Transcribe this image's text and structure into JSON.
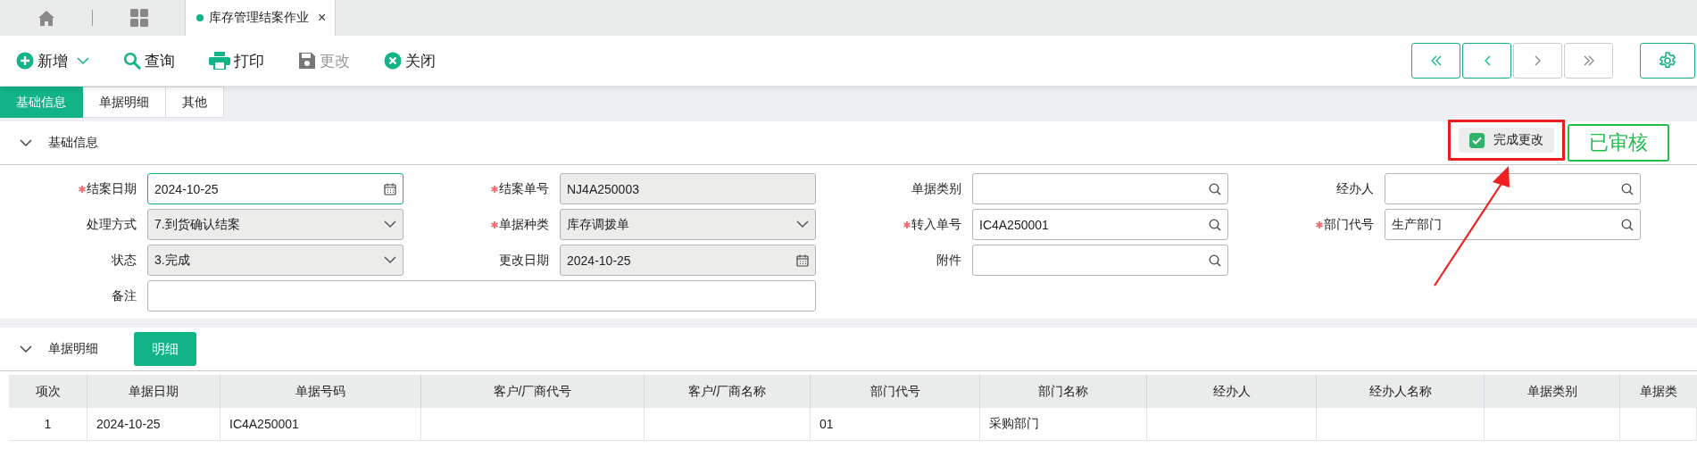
{
  "tab_bar": {
    "tabs": [
      {
        "title": "库存管理结案作业",
        "close": "×",
        "selected": true
      }
    ]
  },
  "toolbar": {
    "buttons": [
      {
        "label": "新增",
        "kind": "add",
        "disabled": false,
        "dropdown": true
      },
      {
        "label": "查询",
        "kind": "search",
        "disabled": false,
        "dropdown": false
      },
      {
        "label": "打印",
        "kind": "print",
        "disabled": false,
        "dropdown": false
      },
      {
        "label": "更改",
        "kind": "save",
        "disabled": true,
        "dropdown": false
      },
      {
        "label": "关闭",
        "kind": "close",
        "disabled": false,
        "dropdown": false
      }
    ],
    "nav_buttons": [
      {
        "kind": "first",
        "disabled": false
      },
      {
        "kind": "prev",
        "disabled": false
      },
      {
        "kind": "next",
        "disabled": true
      },
      {
        "kind": "last",
        "disabled": true
      }
    ]
  },
  "page_tabs": [
    {
      "label": "基础信息",
      "selected": true
    },
    {
      "label": "单据明细",
      "selected": false
    },
    {
      "label": "其他",
      "selected": false
    }
  ],
  "basic_info": {
    "title": "基础信息",
    "expanded": true,
    "finish_change": {
      "label": "完成更改",
      "checked": true
    },
    "status_stamp": "已审核",
    "rows": [
      [
        {
          "label": "结案日期",
          "kind": "date",
          "value": "2024-10-25",
          "required": true,
          "readonly": false,
          "focused": true
        },
        {
          "label": "结案单号",
          "kind": "text",
          "value": "NJ4A250003",
          "required": true,
          "readonly": true,
          "focused": false
        },
        {
          "label": "单据类别",
          "kind": "lookup",
          "required": false,
          "readonly": false,
          "focused": false
        },
        {
          "label": "经办人",
          "kind": "lookup",
          "required": false,
          "readonly": false,
          "focused": false
        }
      ],
      [
        {
          "label": "处理方式",
          "kind": "select",
          "value": "7.到货确认结案",
          "required": false,
          "readonly": true,
          "focused": false
        },
        {
          "label": "单据种类",
          "kind": "select",
          "value": "库存调拨单",
          "required": true,
          "readonly": true,
          "focused": false
        },
        {
          "label": "转入单号",
          "kind": "lookup",
          "value": "IC4A250001",
          "required": true,
          "readonly": false,
          "focused": false
        },
        {
          "label": "部门代号",
          "kind": "lookup",
          "value": "生产部门",
          "required": true,
          "readonly": false,
          "focused": false
        }
      ],
      [
        {
          "label": "状态",
          "kind": "select",
          "value": "3.完成",
          "required": false,
          "readonly": true,
          "focused": false
        },
        {
          "label": "更改日期",
          "kind": "date",
          "value": "2024-10-25",
          "required": false,
          "readonly": true,
          "focused": false
        },
        {
          "label": "附件",
          "kind": "lookup",
          "required": false,
          "readonly": false,
          "focused": false
        }
      ],
      [
        {
          "label": "备注",
          "kind": "memo",
          "required": false,
          "readonly": false,
          "focused": false
        }
      ]
    ]
  },
  "detail": {
    "title": "单据明细",
    "expanded": true,
    "button": "明细",
    "table": {
      "columns": [
        "项次",
        "单据日期",
        "单据号码",
        "客户/厂商代号",
        "客户/厂商名称",
        "部门代号",
        "部门名称",
        "经办人",
        "经办人名称",
        "单据类别",
        "单据类"
      ],
      "rows": [
        [
          "1",
          "2024-10-25",
          "IC4A250001",
          null,
          null,
          "01",
          "采购部门",
          null,
          null,
          null,
          null
        ]
      ]
    }
  }
}
